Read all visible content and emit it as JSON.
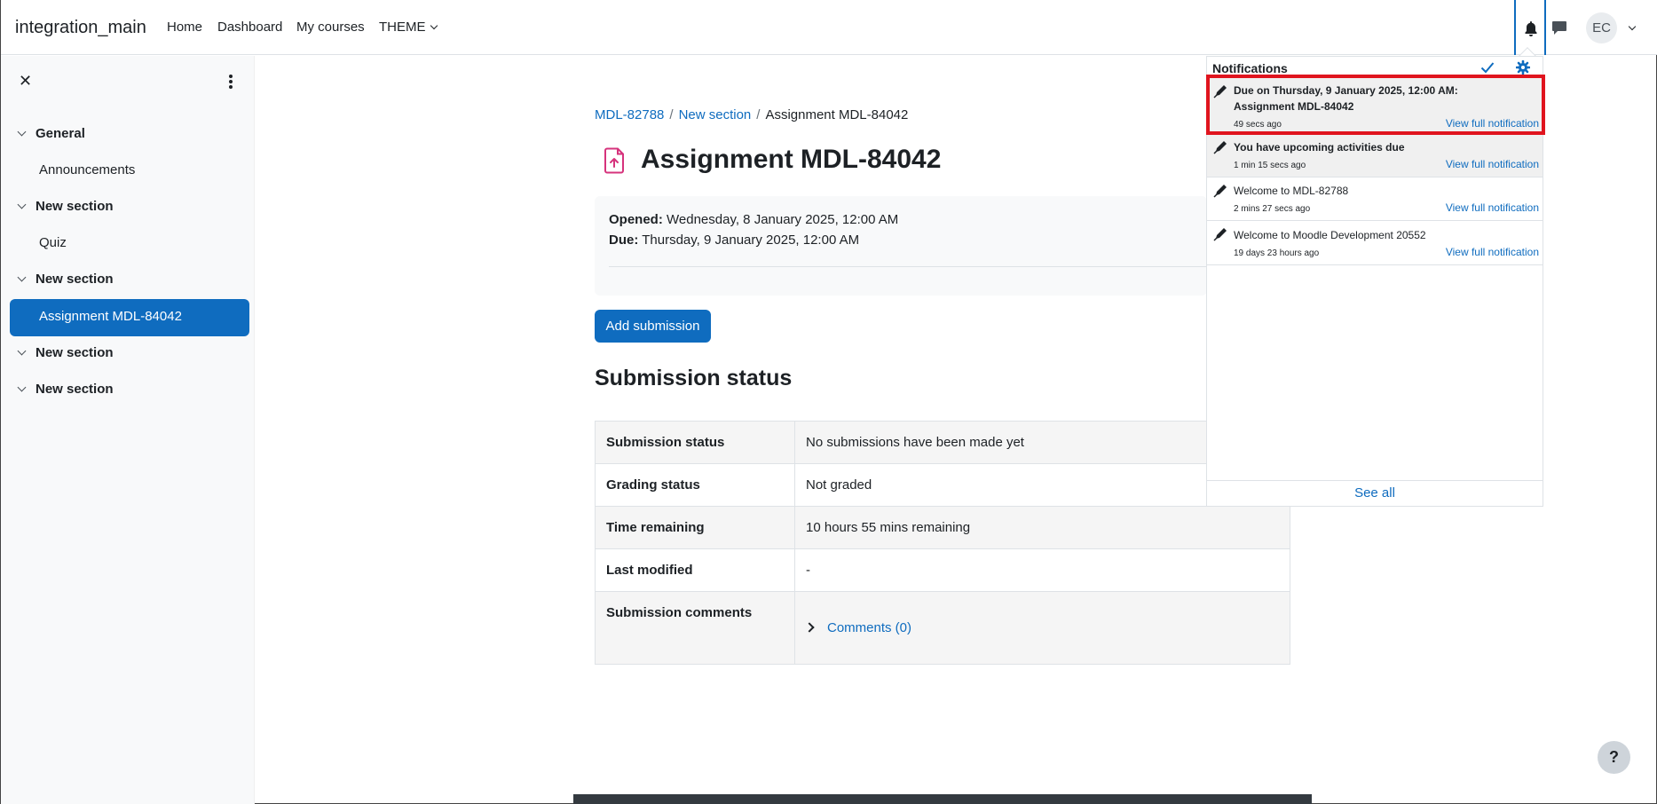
{
  "site_name": "integration_main",
  "nav": {
    "home": "Home",
    "dashboard": "Dashboard",
    "my_courses": "My courses",
    "theme": "THEME"
  },
  "user": {
    "initials": "EC"
  },
  "drawer": {
    "close": "✕",
    "sections": [
      {
        "title": "General",
        "items": [
          "Announcements"
        ]
      },
      {
        "title": "New section",
        "items": [
          "Quiz"
        ]
      },
      {
        "title": "New section",
        "items": [
          "Assignment MDL-84042"
        ]
      },
      {
        "title": "New section",
        "items": []
      },
      {
        "title": "New section",
        "items": []
      }
    ]
  },
  "breadcrumb": {
    "course": "MDL-82788",
    "section": "New section",
    "current": "Assignment MDL-84042"
  },
  "page": {
    "title": "Assignment MDL-84042",
    "opened_label": "Opened:",
    "opened_value": "Wednesday, 8 January 2025, 12:00 AM",
    "due_label": "Due:",
    "due_value": "Thursday, 9 January 2025, 12:00 AM",
    "add_submission": "Add submission",
    "status_heading": "Submission status"
  },
  "status_table": [
    {
      "label": "Submission status",
      "value": "No submissions have been made yet"
    },
    {
      "label": "Grading status",
      "value": "Not graded"
    },
    {
      "label": "Time remaining",
      "value": "10 hours 55 mins remaining"
    },
    {
      "label": "Last modified",
      "value": "-"
    },
    {
      "label": "Submission comments",
      "value": "Comments (0)"
    }
  ],
  "notifications": {
    "title": "Notifications",
    "view_label": "View full notification",
    "see_all": "See all",
    "items": [
      {
        "text": "Due on Thursday, 9 January 2025, 12:00 AM: Assignment MDL-84042",
        "time": "49 secs ago",
        "unread": true
      },
      {
        "text": "You have upcoming activities due",
        "time": "1 min 15 secs ago",
        "unread": true
      },
      {
        "text": "Welcome to MDL-82788",
        "time": "2 mins 27 secs ago",
        "unread": false
      },
      {
        "text": "Welcome to Moodle Development 20552",
        "time": "19 days 23 hours ago",
        "unread": false
      }
    ]
  },
  "help": "?",
  "colors": {
    "primary": "#0f6cbf",
    "highlight": "#e0141e",
    "assignment_icon": "#d6337c"
  }
}
